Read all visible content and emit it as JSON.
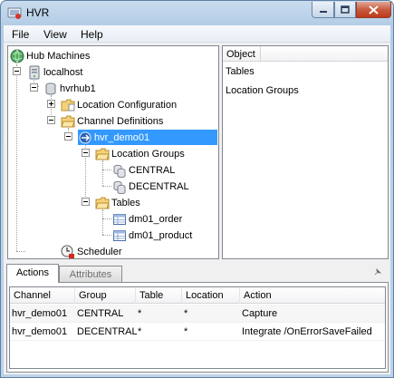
{
  "window": {
    "title": "HVR",
    "menu": [
      "File",
      "View",
      "Help"
    ]
  },
  "tree": {
    "hub_machines": "Hub Machines",
    "localhost": "localhost",
    "hvrhub": "hvrhub1",
    "location_configuration": "Location Configuration",
    "channel_definitions": "Channel Definitions",
    "channel": "hvr_demo01",
    "location_groups": "Location Groups",
    "central": "CENTRAL",
    "decentral": "DECENTRAL",
    "tables": "Tables",
    "table1": "dm01_order",
    "table2": "dm01_product",
    "scheduler": "Scheduler"
  },
  "object_pane": {
    "header": "Object",
    "items": [
      "Tables",
      "Location Groups"
    ]
  },
  "tabs": {
    "actions": "Actions",
    "attributes": "Attributes"
  },
  "grid": {
    "columns": [
      "Channel",
      "Group",
      "Table",
      "Location",
      "Action"
    ],
    "rows": [
      [
        "hvr_demo01",
        "CENTRAL",
        "*",
        "*",
        "Capture"
      ],
      [
        "hvr_demo01",
        "DECENTRAL",
        "*",
        "*",
        "Integrate /OnErrorSaveFailed"
      ]
    ]
  },
  "colors": {
    "selection": "#3399ff",
    "folder": "#f5d27a",
    "close_button": "#c0391b"
  }
}
